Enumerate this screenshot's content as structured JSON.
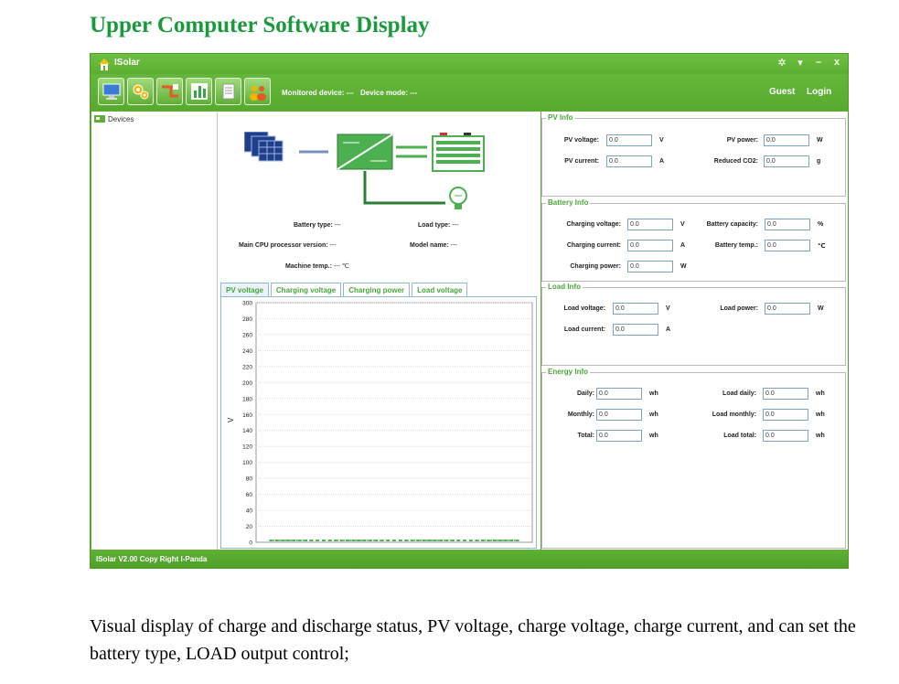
{
  "document": {
    "heading": "Upper Computer Software Display",
    "caption": "Visual display of charge and discharge status, PV voltage, charge voltage, charge current, and can set the battery type, LOAD output control;"
  },
  "window": {
    "title": "ISolar",
    "controls": {
      "settings": "✲",
      "pin": "▾",
      "minimize": "–",
      "close": "x"
    }
  },
  "toolbar": {
    "buttons": [
      "monitor-icon",
      "gears-icon",
      "wiring-icon",
      "bar-chart-icon",
      "document-icon",
      "users-icon"
    ],
    "monitored_device": "Monitored device: ---",
    "device_mode": "Device mode: ---",
    "guest": "Guest",
    "login": "Login"
  },
  "sidebar": {
    "root_label": "Devices"
  },
  "device_info": {
    "battery_type_label": "Battery type:",
    "battery_type_value": "---",
    "load_type_label": "Load type:",
    "load_type_value": "---",
    "cpu_label": "Main CPU processor version:",
    "cpu_value": "---",
    "model_label": "Model name:",
    "model_value": "---",
    "machine_temp_label": "Machine temp.:",
    "machine_temp_value": "--- ℃"
  },
  "tabs": [
    "PV voltage",
    "Charging voltage",
    "Charging power",
    "Load voltage"
  ],
  "chart_data": {
    "type": "line",
    "ylabel": "V",
    "ylim": [
      0,
      300
    ],
    "yticks": [
      0,
      20,
      40,
      60,
      80,
      100,
      120,
      140,
      160,
      180,
      200,
      220,
      240,
      260,
      280,
      300
    ],
    "grid": true,
    "series": [
      {
        "values": [
          0,
          0,
          0,
          0,
          0,
          0,
          0,
          0,
          0,
          0,
          0,
          0,
          0,
          0,
          0,
          0,
          0,
          0,
          0,
          0,
          0,
          0,
          0,
          0,
          0,
          0,
          0,
          0,
          0,
          0,
          0,
          0,
          0,
          0,
          0,
          0,
          0,
          0,
          0,
          0,
          0,
          0,
          0
        ],
        "color": "#4caf50"
      }
    ]
  },
  "pv_info": {
    "title": "PV Info",
    "pv_voltage": {
      "label": "PV voltage:",
      "value": "0.0",
      "unit": "V"
    },
    "pv_power": {
      "label": "PV power:",
      "value": "0.0",
      "unit": "W"
    },
    "pv_current": {
      "label": "PV current:",
      "value": "0.0",
      "unit": "A"
    },
    "reduced_co2": {
      "label": "Reduced CO2:",
      "value": "0.0",
      "unit": "g"
    }
  },
  "battery_info": {
    "title": "Battery Info",
    "charging_voltage": {
      "label": "Charging voltage:",
      "value": "0.0",
      "unit": "V"
    },
    "battery_capacity": {
      "label": "Battery capacity:",
      "value": "0.0",
      "unit": "%"
    },
    "charging_current": {
      "label": "Charging current:",
      "value": "0.0",
      "unit": "A"
    },
    "battery_temp": {
      "label": "Battery temp.:",
      "value": "0.0",
      "unit": "℃"
    },
    "charging_power": {
      "label": "Charging power:",
      "value": "0.0",
      "unit": "W"
    }
  },
  "load_info": {
    "title": "Load Info",
    "load_voltage": {
      "label": "Load voltage:",
      "value": "0.0",
      "unit": "V"
    },
    "load_power": {
      "label": "Load power:",
      "value": "0.0",
      "unit": "W"
    },
    "load_current": {
      "label": "Load current:",
      "value": "0.0",
      "unit": "A"
    }
  },
  "energy_info": {
    "title": "Energy Info",
    "daily": {
      "label": "Daily:",
      "value": "0.0",
      "unit": "wh"
    },
    "load_daily": {
      "label": "Load daily:",
      "value": "0.0",
      "unit": "wh"
    },
    "monthly": {
      "label": "Monthly:",
      "value": "0.0",
      "unit": "wh"
    },
    "load_monthly": {
      "label": "Load monthly:",
      "value": "0.0",
      "unit": "wh"
    },
    "total": {
      "label": "Total:",
      "value": "0.0",
      "unit": "wh"
    },
    "load_total": {
      "label": "Load total:",
      "value": "0.0",
      "unit": "wh"
    }
  },
  "statusbar": {
    "version": "ISolar V2.00   Copy Right I-Panda"
  },
  "colors": {
    "app_green": "#5fae35",
    "accent_green": "#4aa63a",
    "heading_green": "#1a9a3c",
    "input_border": "#7fa3c7"
  }
}
